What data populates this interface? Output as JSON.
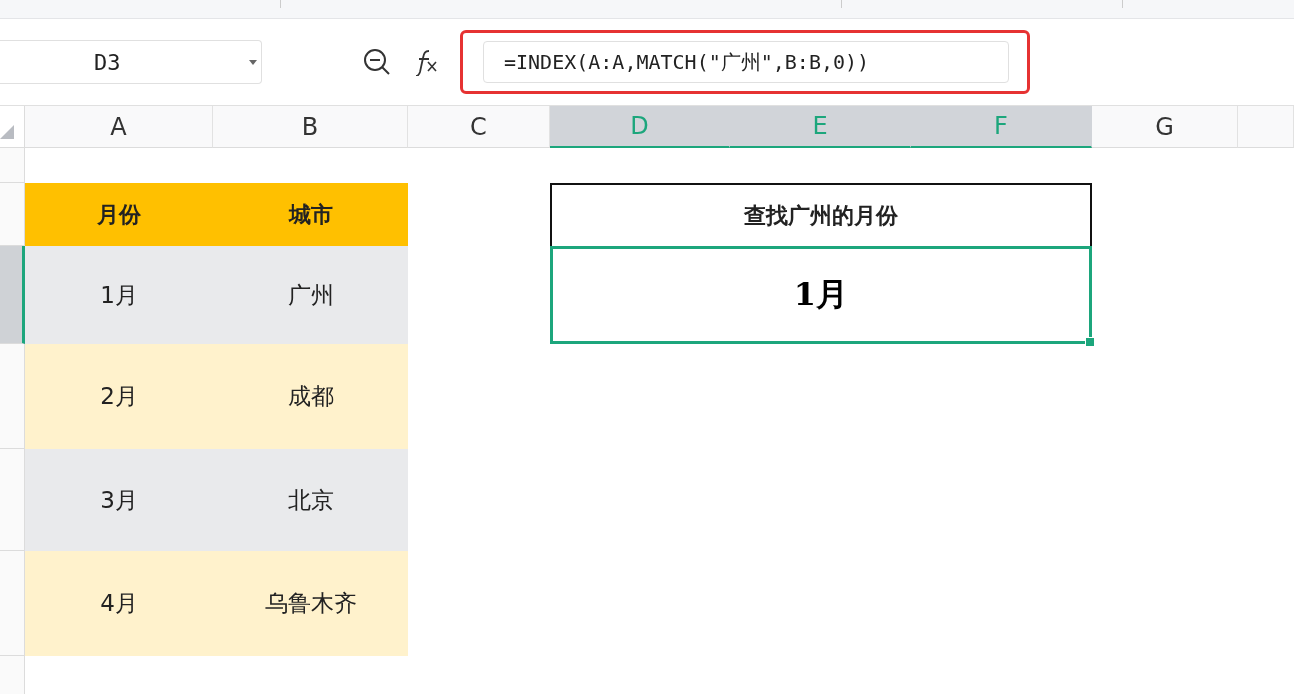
{
  "name_box": {
    "value": "D3"
  },
  "formula_bar": {
    "value": "=INDEX(A:A,MATCH(\"广州\",B:B,0))",
    "highlighted": true
  },
  "columns": [
    {
      "label": "A",
      "selected": false
    },
    {
      "label": "B",
      "selected": false
    },
    {
      "label": "C",
      "selected": false
    },
    {
      "label": "D",
      "selected": true
    },
    {
      "label": "E",
      "selected": true
    },
    {
      "label": "F",
      "selected": true
    },
    {
      "label": "G",
      "selected": false
    }
  ],
  "row_headers": [
    {
      "selected": false
    },
    {
      "selected": false
    },
    {
      "selected": true
    },
    {
      "selected": false
    },
    {
      "selected": false
    },
    {
      "selected": false
    },
    {
      "selected": false
    }
  ],
  "table": {
    "headers": [
      "月份",
      "城市"
    ],
    "rows": [
      {
        "cells": [
          "1月",
          "广州"
        ],
        "color": "#e9eaec"
      },
      {
        "cells": [
          "2月",
          "成都"
        ],
        "color": "#fff2cc"
      },
      {
        "cells": [
          "3月",
          "北京"
        ],
        "color": "#e9eaec"
      },
      {
        "cells": [
          "4月",
          "乌鲁木齐"
        ],
        "color": "#fff2cc"
      }
    ]
  },
  "lookup": {
    "title": "查找广州的月份",
    "result": "1月",
    "selected": true
  }
}
